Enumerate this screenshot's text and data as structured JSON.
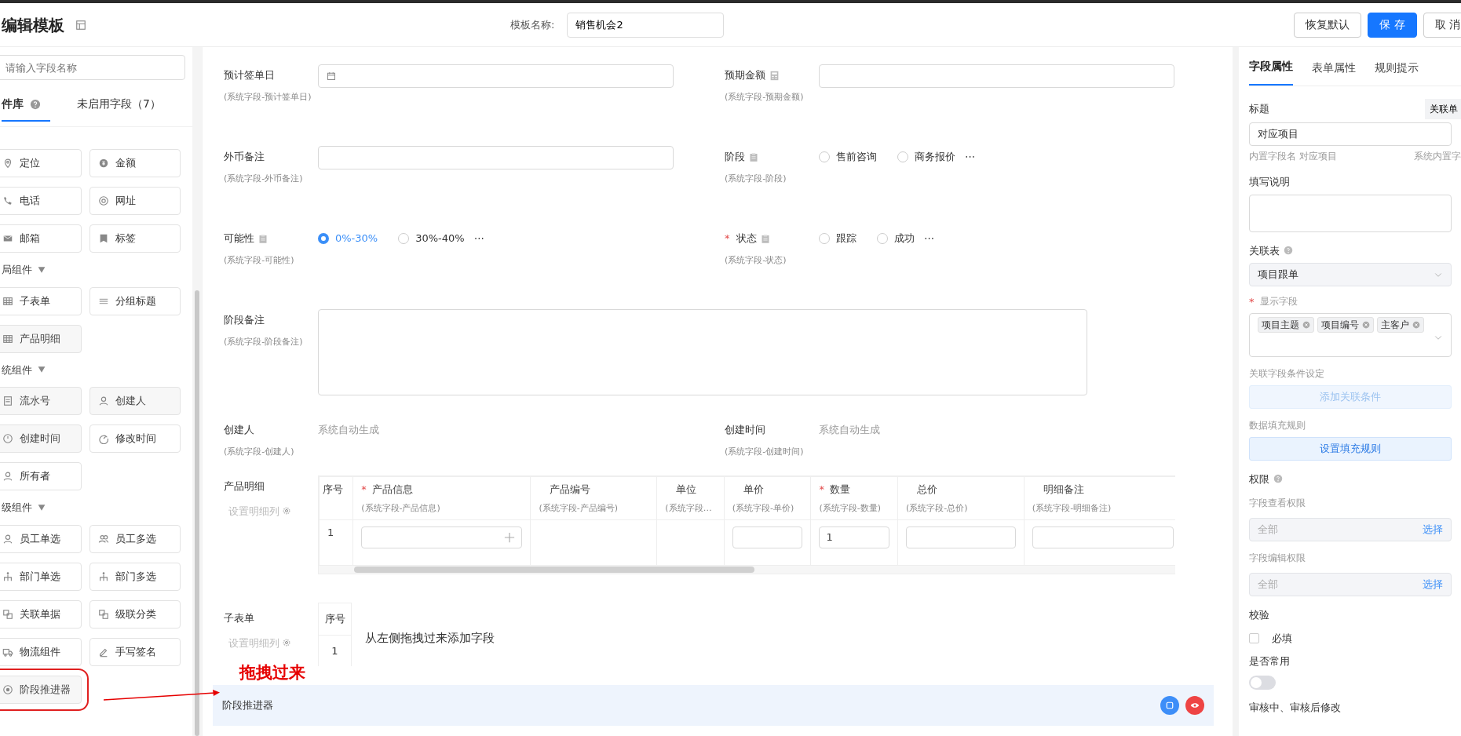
{
  "header": {
    "title": "编辑模板",
    "template_name_label": "模板名称:",
    "template_name": "销售机会2",
    "buttons": [
      {
        "label": "恢复默认",
        "kind": "default"
      },
      {
        "label": "保 存",
        "kind": "primary"
      },
      {
        "label": "取 消",
        "kind": "default"
      }
    ]
  },
  "left_panel": {
    "search": {
      "placeholder": "请输入字段名称"
    },
    "tabs": [
      {
        "label": "件库",
        "selected": true,
        "help": true
      },
      {
        "label": "未启用字段（7）",
        "selected": false,
        "help": false
      }
    ],
    "groups": [
      {
        "items": [
          {
            "label": "定位",
            "disabled": false
          },
          {
            "label": "金额",
            "disabled": false
          },
          {
            "label": "电话",
            "disabled": false
          },
          {
            "label": "网址",
            "disabled": false
          },
          {
            "label": "邮箱",
            "disabled": false
          },
          {
            "label": "标签",
            "disabled": false
          }
        ]
      },
      {
        "title": "局组件",
        "items": [
          {
            "label": "子表单",
            "disabled": false
          },
          {
            "label": "分组标题",
            "disabled": false
          },
          {
            "label": "产品明细",
            "disabled": true
          }
        ]
      },
      {
        "title": "统组件",
        "items": [
          {
            "label": "流水号",
            "disabled": true
          },
          {
            "label": "创建人",
            "disabled": true
          },
          {
            "label": "创建时间",
            "disabled": true
          },
          {
            "label": "修改时间",
            "disabled": false
          },
          {
            "label": "所有者",
            "disabled": false
          }
        ]
      },
      {
        "title": "级组件",
        "items": [
          {
            "label": "员工单选",
            "disabled": false
          },
          {
            "label": "员工多选",
            "disabled": false
          },
          {
            "label": "部门单选",
            "disabled": false
          },
          {
            "label": "部门多选",
            "disabled": false
          },
          {
            "label": "关联单据",
            "disabled": false
          },
          {
            "label": "级联分类",
            "disabled": false
          },
          {
            "label": "物流组件",
            "disabled": false
          },
          {
            "label": "手写签名",
            "disabled": false
          },
          {
            "label": "阶段推进器",
            "disabled": true,
            "annotated": true
          }
        ]
      }
    ]
  },
  "annotation": {
    "text": "拖拽过来"
  },
  "form": {
    "rows": [
      [
        {
          "label": "预计签单日",
          "hint": "(系统字段-预计签单日)",
          "kind": "date"
        },
        {
          "label": "预期金额",
          "hint": "(系统字段-预期金额)",
          "kind": "number"
        }
      ],
      [
        {
          "label": "外币备注",
          "hint": "(系统字段-外币备注)",
          "kind": "text"
        },
        {
          "label": "阶段",
          "hint": "(系统字段-阶段)",
          "kind": "radio",
          "options": [
            {
              "label": "售前咨询",
              "selected": false
            },
            {
              "label": "商务报价",
              "selected": false
            }
          ],
          "more": "⋯"
        }
      ],
      [
        {
          "label": "可能性",
          "hint": "(系统字段-可能性)",
          "kind": "radio",
          "options": [
            {
              "label": "0%-30%",
              "selected": true
            },
            {
              "label": "30%-40%",
              "selected": false
            }
          ],
          "more": "⋯"
        },
        {
          "label": "状态",
          "required_mark": "*",
          "hint": "(系统字段-状态)",
          "kind": "radio",
          "options": [
            {
              "label": "跟踪",
              "selected": false
            },
            {
              "label": "成功",
              "selected": false
            }
          ],
          "more": "⋯"
        }
      ],
      [
        {
          "label": "阶段备注",
          "hint": "(系统字段-阶段备注)",
          "kind": "textarea"
        }
      ],
      [
        {
          "label": "创建人",
          "hint": "(系统字段-创建人)",
          "kind": "auto",
          "value": "系统自动生成"
        },
        {
          "label": "创建时间",
          "hint": "(系统字段-创建时间)",
          "kind": "auto",
          "value": "系统自动生成"
        }
      ]
    ]
  },
  "product_detail": {
    "label": "产品明细",
    "link": "设置明细列",
    "index_header": "序号",
    "index": "1",
    "columns": [
      {
        "label": "产品信息",
        "required_mark": "*",
        "hint": "(系统字段-产品信息)",
        "kind": "picker"
      },
      {
        "label": "产品编号",
        "hint": "(系统字段-产品编号)",
        "kind": "blank"
      },
      {
        "label": "单位",
        "hint": "(系统字段…",
        "kind": "blank"
      },
      {
        "label": "单价",
        "hint": "(系统字段-单价)",
        "kind": "input"
      },
      {
        "label": "数量",
        "required_mark": "*",
        "hint": "(系统字段-数量)",
        "kind": "input",
        "value": "1"
      },
      {
        "label": "总价",
        "hint": "(系统字段-总价)",
        "kind": "input"
      },
      {
        "label": "明细备注",
        "hint": "(系统字段-明细备注)",
        "kind": "input"
      }
    ]
  },
  "subform": {
    "label": "子表单",
    "link": "设置明细列",
    "index_header": "序号",
    "index": "1",
    "hint": "从左侧拖拽过来添加字段"
  },
  "selected_field": {
    "label": "阶段推进器"
  },
  "properties": {
    "tabs": [
      {
        "label": "字段属性",
        "selected": true
      },
      {
        "label": "表单属性",
        "selected": false
      },
      {
        "label": "规则提示",
        "selected": false
      }
    ],
    "title_label": "标题",
    "related_button": "关联单",
    "title_value": "对应项目",
    "builtin_name": "内置字段名 对应项目",
    "builtin_note": "系统内置字",
    "description_label": "填写说明",
    "related_table_label": "关联表",
    "related_table": "项目跟单",
    "display_fields_label": "显示字段",
    "display_fields_mark": "*",
    "display_fields": [
      "项目主题",
      "项目编号",
      "主客户"
    ],
    "condition_label": "关联字段条件设定",
    "condition_button": {
      "label": "添加关联条件",
      "disabled": true
    },
    "fill_rule_label": "数据填充规则",
    "fill_rule_button": {
      "label": "设置填充规则",
      "disabled": false
    },
    "permission_label": "权限",
    "permissions": [
      {
        "label": "字段查看权限",
        "placeholder": "全部",
        "action": "选择"
      },
      {
        "label": "字段编辑权限",
        "placeholder": "全部",
        "action": "选择"
      }
    ],
    "validation_label": "校验",
    "required_checkbox": {
      "label": "必填",
      "checked": false
    },
    "common_label": "是否常用",
    "common_switch": {
      "on": false
    },
    "review_label": "审核中、审核后修改"
  }
}
